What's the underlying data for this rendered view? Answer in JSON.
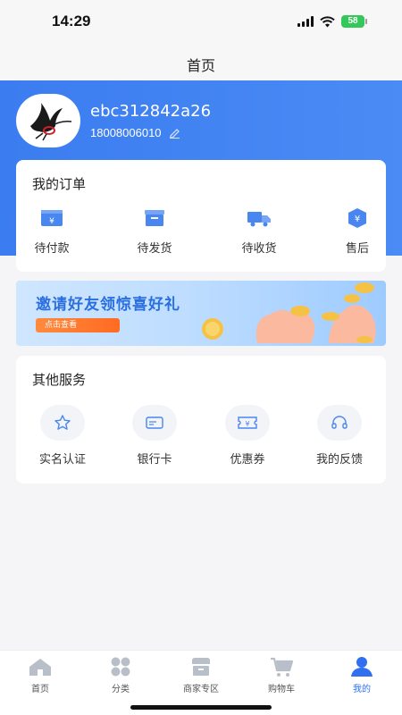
{
  "status_bar": {
    "time": "14:29",
    "battery": "58"
  },
  "nav": {
    "title": "首页"
  },
  "profile": {
    "username": "ebc312842a26",
    "phone": "18008006010"
  },
  "orders": {
    "title": "我的订单",
    "items": [
      {
        "label": "待付款",
        "icon": "wallet-icon"
      },
      {
        "label": "待发货",
        "icon": "box-icon"
      },
      {
        "label": "待收货",
        "icon": "truck-icon"
      },
      {
        "label": "售后",
        "icon": "shield-yen-icon"
      }
    ]
  },
  "banner": {
    "text": "邀请好友领惊喜好礼",
    "button": "点击查看"
  },
  "services": {
    "title": "其他服务",
    "items": [
      {
        "label": "实名认证",
        "icon": "star-icon"
      },
      {
        "label": "银行卡",
        "icon": "card-icon"
      },
      {
        "label": "优惠券",
        "icon": "coupon-icon"
      },
      {
        "label": "我的反馈",
        "icon": "headset-icon"
      }
    ]
  },
  "tab_bar": {
    "items": [
      {
        "label": "首页",
        "icon": "home-icon",
        "active": false
      },
      {
        "label": "分类",
        "icon": "grid-icon",
        "active": false
      },
      {
        "label": "商家专区",
        "icon": "store-icon",
        "active": false
      },
      {
        "label": "购物车",
        "icon": "cart-icon",
        "active": false
      },
      {
        "label": "我的",
        "icon": "user-icon",
        "active": true
      }
    ]
  },
  "colors": {
    "primary": "#3b7cf0",
    "accent_orange": "#ff6b22",
    "active_tab": "#2f6ff0"
  }
}
